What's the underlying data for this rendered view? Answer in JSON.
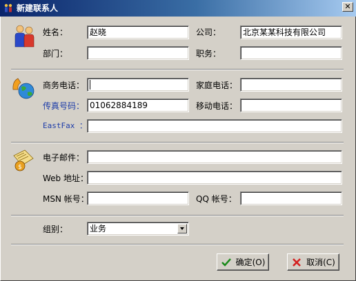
{
  "window": {
    "title": "新建联系人",
    "close_label": "✕"
  },
  "contact": {
    "name_label": "姓名：",
    "name_value": "赵晓",
    "company_label": "公司：",
    "company_value": "北京某某科技有限公司",
    "dept_label": "部门：",
    "dept_value": "",
    "title_label": "职务：",
    "title_value": ""
  },
  "phones": {
    "work_label": "商务电话：",
    "work_value": "",
    "home_label": "家庭电话：",
    "home_value": "",
    "fax_label": "传真号码：",
    "fax_value": "01062884189",
    "mobile_label": "移动电话：",
    "mobile_value": "",
    "eastfax_label": "EastFax ：",
    "eastfax_value": ""
  },
  "internet": {
    "email_label": "电子邮件：",
    "email_value": "",
    "web_label": "Web 地址：",
    "web_value": "",
    "msn_label": "MSN 帐号：",
    "msn_value": "",
    "qq_label": "QQ 帐号：",
    "qq_value": ""
  },
  "group": {
    "label": "组别：",
    "selected": "业务"
  },
  "buttons": {
    "ok_label": "确定(O)",
    "cancel_label": "取消(C)"
  }
}
